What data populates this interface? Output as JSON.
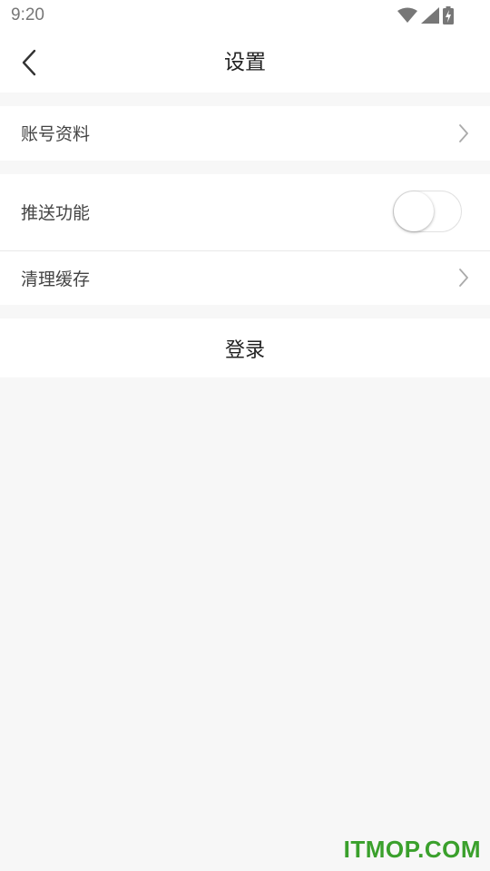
{
  "status_bar": {
    "time": "9:20",
    "icons": [
      "wifi-icon",
      "signal-icon",
      "battery-charging-icon"
    ]
  },
  "header": {
    "title": "设置",
    "back_icon": "chevron-left-icon"
  },
  "settings": {
    "account": {
      "label": "账号资料",
      "icon": "chevron-right-icon"
    },
    "push": {
      "label": "推送功能",
      "enabled": false
    },
    "cache": {
      "label": "清理缓存",
      "icon": "chevron-right-icon"
    }
  },
  "login": {
    "label": "登录"
  },
  "watermark": {
    "text": "ITMOP.COM"
  },
  "colors": {
    "background": "#f7f7f7",
    "surface": "#ffffff",
    "text": "#333333",
    "watermark": "#3aa02c"
  }
}
